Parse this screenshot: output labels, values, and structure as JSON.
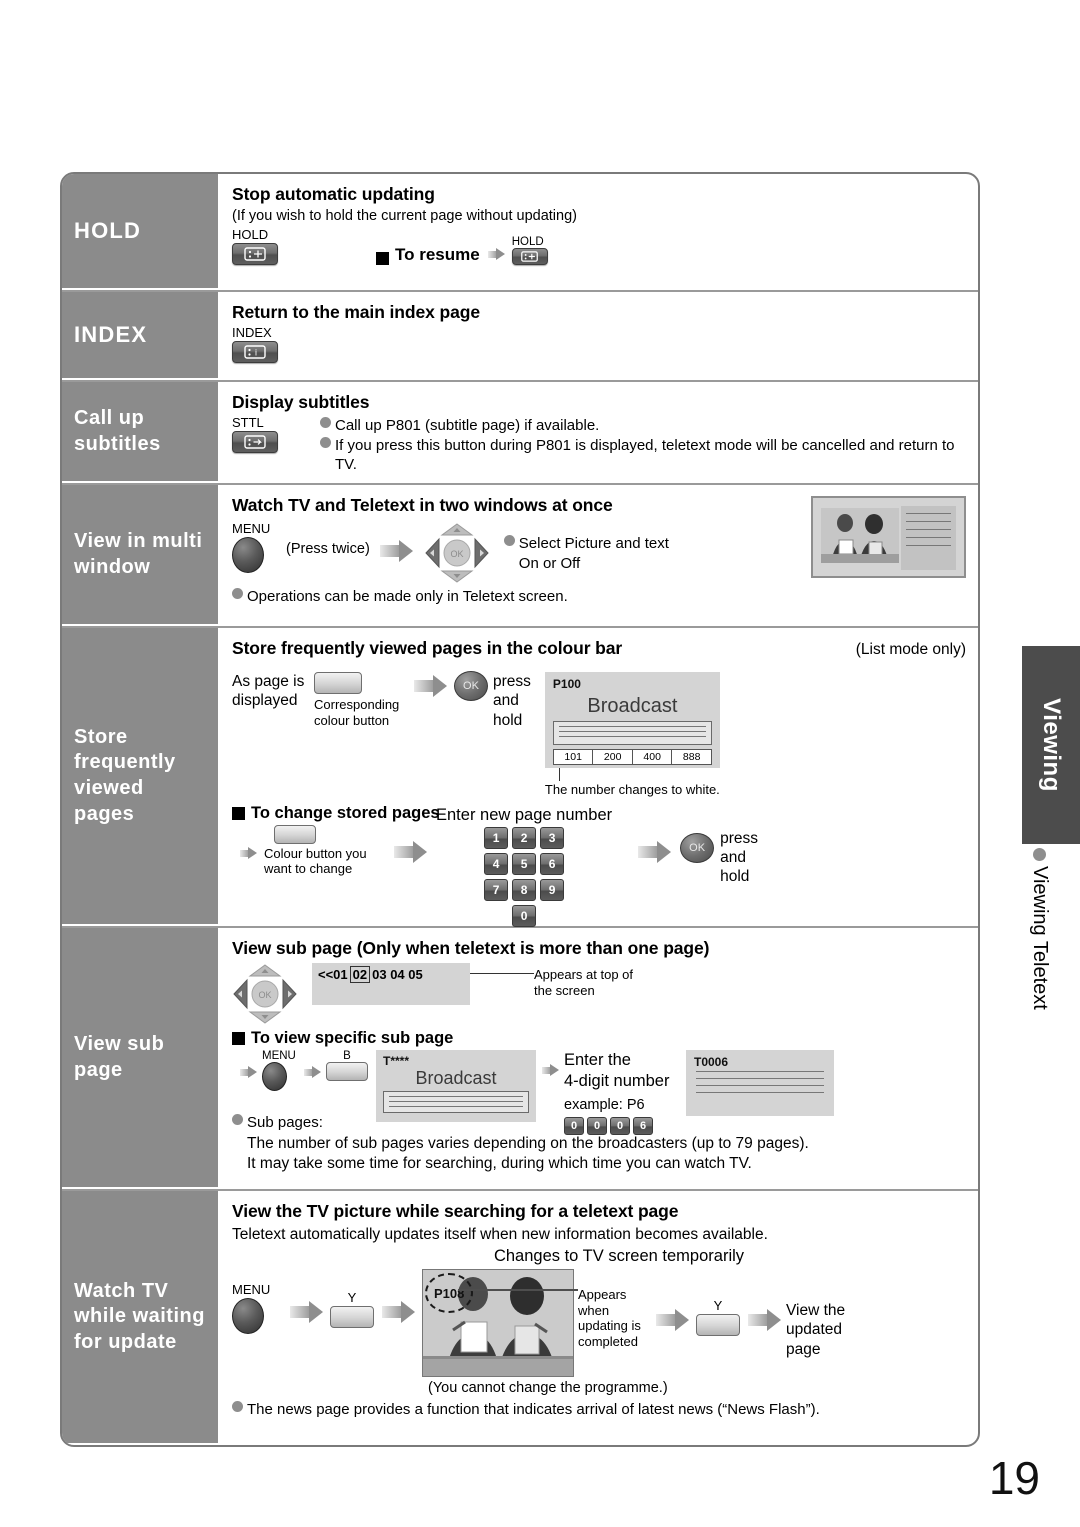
{
  "page": {
    "number": "19"
  },
  "side_tab": {
    "label": "Viewing",
    "sub_label": "Viewing Teletext",
    "bullet_icon": "bullet-dot-icon"
  },
  "sections": [
    {
      "key": "hold",
      "label": "HOLD",
      "title": "Stop automatic updating",
      "subtitle": "(If you wish to hold the current page without updating)",
      "button_label": "HOLD",
      "button_icon": "hold-remote-button-icon",
      "resume_text": "To resume",
      "resume_button_label": "HOLD",
      "resume_button_icon": "hold-remote-button-icon",
      "arrow_icon": "right-arrow-icon"
    },
    {
      "key": "index",
      "label": "INDEX",
      "title": "Return to the main index page",
      "button_label": "INDEX",
      "button_icon": "index-remote-button-icon"
    },
    {
      "key": "subtitles",
      "label": "Call up subtitles",
      "title": "Display subtitles",
      "button_label": "STTL",
      "button_icon": "sttl-remote-button-icon",
      "bullets": [
        "Call up P801 (subtitle page) if available.",
        "If you press this button during P801 is displayed, teletext mode will be cancelled and return to TV."
      ]
    },
    {
      "key": "multiwindow",
      "label": "View in multi window",
      "title": "Watch TV and Teletext in two windows at once",
      "menu_label": "MENU",
      "menu_icon": "menu-round-button-icon",
      "press_twice": "(Press twice)",
      "arrow_icon": "right-arrow-icon",
      "dpad_icon": "dpad-navigation-icon",
      "ok_label": "OK",
      "bullet_right": "Select Picture and text\nOn or Off",
      "bullet_right_line1": "Select Picture and text",
      "bullet_right_line2": "On or Off",
      "bullet_bottom": "Operations can be made only in Teletext screen.",
      "tv_preview_icon": "multi-window-tv-preview-icon"
    },
    {
      "key": "store",
      "label": "Store frequently viewed pages",
      "title": "Store frequently viewed pages in the colour bar",
      "note": "(List mode only)",
      "as_page_line1": "As page is",
      "as_page_line2": "displayed",
      "colour_button_caption_line1": "Corresponding",
      "colour_button_caption_line2": "colour button",
      "colour_button_icon": "colour-remote-button-icon",
      "arrow_icon": "right-arrow-icon",
      "ok_label": "OK",
      "press_hold_line1": "press",
      "press_hold_line2": "and",
      "press_hold_line3": "hold",
      "tv": {
        "page_code": "P100",
        "broadcast": "Broadcast",
        "colour_bar": [
          "101",
          "200",
          "400",
          "888"
        ]
      },
      "white_note": "The number changes to white.",
      "change_head": "To change stored pages",
      "change_colour_caption_line1": "Colour button you",
      "change_colour_caption_line2": "want to change",
      "enter_new_page": "Enter new page number",
      "keypad": [
        "1",
        "2",
        "3",
        "4",
        "5",
        "6",
        "7",
        "8",
        "9",
        "0"
      ]
    },
    {
      "key": "subpage",
      "label": "View sub page",
      "title": "View sub page (Only when teletext is more than one page)",
      "dpad_icon": "dpad-navigation-icon",
      "ok_label": "OK",
      "subpage_strip_prefix": "<<01",
      "subpage_strip_selected": "02",
      "subpage_strip_rest": "03 04 05",
      "appears_line1": "Appears at top of",
      "appears_line2": "the screen",
      "specific_head": "To view specific sub page",
      "menu_label": "MENU",
      "menu_icon": "menu-round-button-icon",
      "b_label": "B",
      "b_button_icon": "colour-remote-button-icon",
      "arrow_icon": "right-arrow-icon",
      "tv1": {
        "page_code": "T****",
        "broadcast": "Broadcast"
      },
      "enter_line1": "Enter the",
      "enter_line2": "4-digit number",
      "example": "example: P6",
      "example_keys": [
        "0",
        "0",
        "0",
        "6"
      ],
      "tv2": {
        "page_code": "T0006"
      },
      "sub_pages_label": "Sub pages:",
      "sub_pages_line1": "The number of sub pages varies depending on the broadcasters (up to 79 pages).",
      "sub_pages_line2": "It may take some time for searching, during which time you can watch TV."
    },
    {
      "key": "watch",
      "label": "Watch TV while waiting for update",
      "title": "View the TV picture while searching for a teletext page",
      "subtitle": "Teletext automatically updates itself when new information becomes available.",
      "changes_note": "Changes to TV screen temporarily",
      "menu_label": "MENU",
      "menu_icon": "menu-round-button-icon",
      "y_label": "Y",
      "y_button_icon": "colour-remote-button-icon",
      "arrow_icon": "right-arrow-icon",
      "tv": {
        "page_code": "P108",
        "photo_icon": "tv-newsroom-photo-icon"
      },
      "appears_line1": "Appears",
      "appears_line2": "when",
      "appears_line3": "updating is",
      "appears_line4": "completed",
      "y_label2": "Y",
      "view_updated_line1": "View the",
      "view_updated_line2": "updated",
      "view_updated_line3": "page",
      "cannot_change": "(You cannot change the programme.)",
      "news_flash": "The news page provides a function that indicates arrival of latest news (“News Flash”)."
    }
  ],
  "colors": {
    "label_bg": "#8b8b8b",
    "tab_bg": "#4c4c4c",
    "tv_bg": "#d4d4d4",
    "bullet": "#8e8e8e",
    "frame_border": "#7a7a7a"
  }
}
